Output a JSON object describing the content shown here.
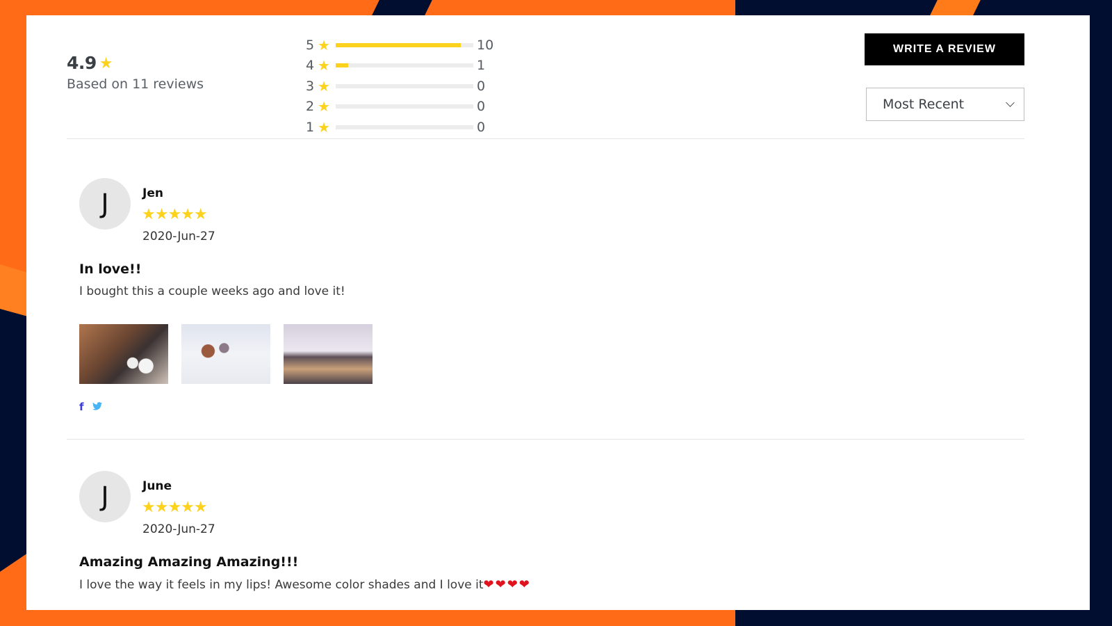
{
  "summary": {
    "average": "4.9",
    "based_on": "Based on 11 reviews",
    "breakdown": [
      {
        "stars": "5",
        "count": "10",
        "fraction": 0.909
      },
      {
        "stars": "4",
        "count": "1",
        "fraction": 0.091
      },
      {
        "stars": "3",
        "count": "0",
        "fraction": 0
      },
      {
        "stars": "2",
        "count": "0",
        "fraction": 0
      },
      {
        "stars": "1",
        "count": "0",
        "fraction": 0
      }
    ]
  },
  "actions": {
    "write_review": "WRITE A REVIEW",
    "sort_selected": "Most Recent"
  },
  "icons": {
    "star": "★",
    "five_stars": "★★★★★",
    "facebook": "f",
    "hearts": "❤❤❤❤"
  },
  "reviews": [
    {
      "initial": "J",
      "name": "Jen",
      "rating": 5,
      "date": "2020-Jun-27",
      "title": "In love!!",
      "body": "I bought this a couple weeks ago and love it!",
      "photos": [
        "makeup-brushes-on-tray",
        "brushes-in-white-cups",
        "eyeshadow-palette-and-brushes"
      ]
    },
    {
      "initial": "J",
      "name": "June",
      "rating": 5,
      "date": "2020-Jun-27",
      "title": "Amazing Amazing Amazing!!!",
      "body": "I love the way it feels in my lips! Awesome color shades and I love it"
    }
  ],
  "colors": {
    "star": "#fcd21c",
    "bg_orange": "#ff6b17",
    "bg_navy": "#020e30",
    "facebook": "#3b3bd6",
    "twitter": "#4ab3f4",
    "heart": "#e0121e"
  }
}
